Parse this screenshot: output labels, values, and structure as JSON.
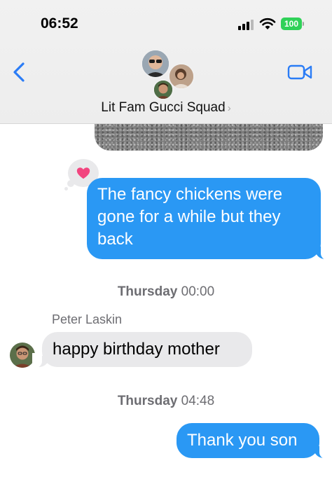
{
  "status_bar": {
    "time": "06:52",
    "battery": "100",
    "battery_color": "#2fd158"
  },
  "header": {
    "back_icon": "chevron-left-icon",
    "video_icon": "video-camera-icon",
    "group_name": "Lit Fam Gucci Squad",
    "accent_color": "#2a7cf6"
  },
  "messages": [
    {
      "direction": "outgoing",
      "text": "The fancy chickens were gone for a while but they back",
      "reaction": "heart-icon",
      "reaction_color": "#f2457f"
    },
    {
      "timestamp_day": "Thursday",
      "timestamp_time": "00:00"
    },
    {
      "direction": "incoming",
      "sender": "Peter Laskin",
      "text": "happy birthday mother"
    },
    {
      "timestamp_day": "Thursday",
      "timestamp_time": "04:48"
    },
    {
      "direction": "outgoing",
      "text": "Thank you son"
    }
  ],
  "colors": {
    "outgoing_bubble": "#2a98f4",
    "incoming_bubble": "#e9e9eb"
  }
}
